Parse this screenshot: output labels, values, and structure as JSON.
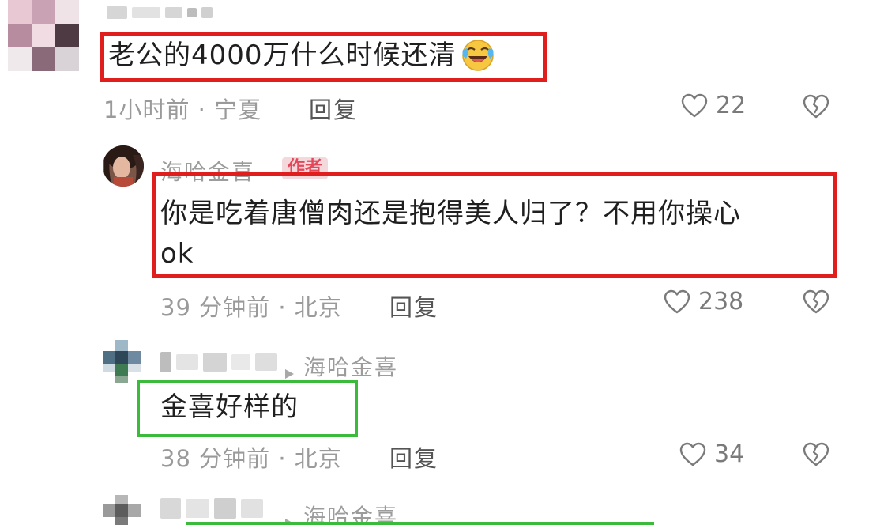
{
  "icons": {
    "like": "heart-outline-icon",
    "dislike": "broken-heart-icon",
    "reply_arrow": "triangle-right-icon",
    "emoji": "laughing-tears-emoji"
  },
  "colors": {
    "highlight_red": "#e01e1e",
    "highlight_green": "#3cba3c",
    "author_badge_bg": "#f4d9dc",
    "author_badge_text": "#e2475a"
  },
  "comments": [
    {
      "text": "老公的4000万什么时候还清",
      "time_location": "1小时前 · 宁夏",
      "reply_label": "回复",
      "likes": "22"
    },
    {
      "username": "海哈金喜",
      "badge": "作者",
      "text_line1": "你是吃着唐僧肉还是抱得美人归了？不用你操心",
      "text_line2": "ok",
      "time_location": "39 分钟前 · 北京",
      "reply_label": "回复",
      "likes": "238"
    },
    {
      "reply_to": "海哈金喜",
      "text": "金喜好样的",
      "time_location": "38 分钟前 · 北京",
      "reply_label": "回复",
      "likes": "34"
    },
    {
      "reply_to": "海哈金喜"
    }
  ]
}
